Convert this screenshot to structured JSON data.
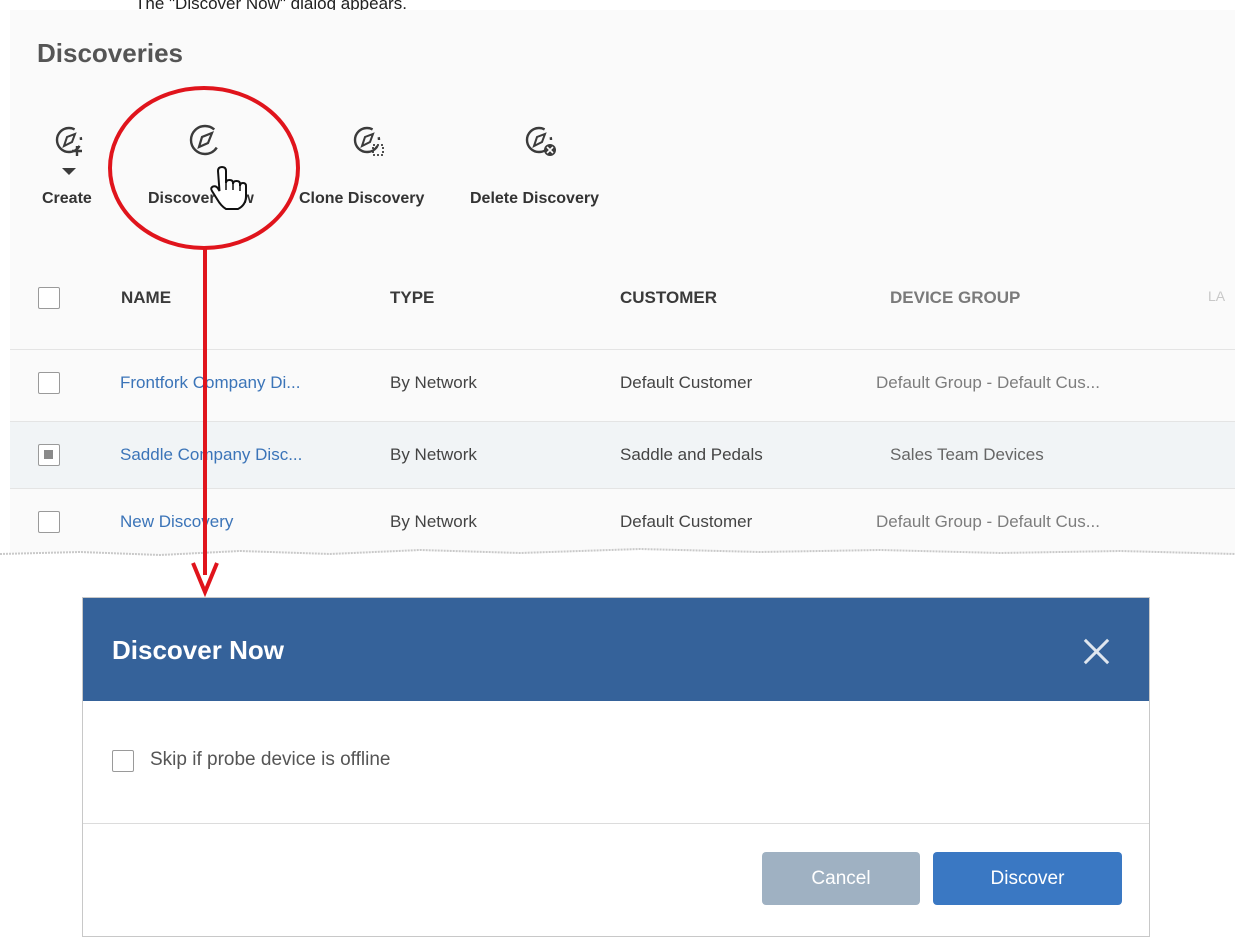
{
  "caption": "The \"Discover Now\" dialog appears.",
  "page": {
    "title": "Discoveries"
  },
  "toolbar": {
    "create": "Create",
    "discover_now": "Discover Now",
    "clone": "Clone Discovery",
    "delete": "Delete Discovery"
  },
  "table": {
    "headers": [
      "NAME",
      "TYPE",
      "CUSTOMER",
      "DEVICE GROUP",
      "LA"
    ],
    "rows": [
      {
        "name": "Frontfork Company Di...",
        "type": "By Network",
        "customer": "Default Customer",
        "group": "Default Group - Default Cus...",
        "checked": false
      },
      {
        "name": "Saddle Company Disc...",
        "type": "By Network",
        "customer": "Saddle and Pedals",
        "group": "Sales Team Devices",
        "checked": true
      },
      {
        "name": "New Discovery",
        "type": "By Network",
        "customer": "Default Customer",
        "group": "Default Group - Default Cus...",
        "checked": false
      }
    ]
  },
  "dialog": {
    "title": "Discover Now",
    "checkbox_label": "Skip if probe device is offline",
    "cancel": "Cancel",
    "discover": "Discover"
  },
  "colors": {
    "dialog_header": "#35629a",
    "link": "#3b74b8",
    "annotation": "#e0141c",
    "primary_button": "#3a78c3",
    "cancel_button": "#9fb1c2"
  },
  "icons": [
    "compass-add-icon",
    "compass-icon",
    "compass-clone-icon",
    "compass-delete-icon",
    "hand-cursor-icon",
    "close-icon"
  ]
}
